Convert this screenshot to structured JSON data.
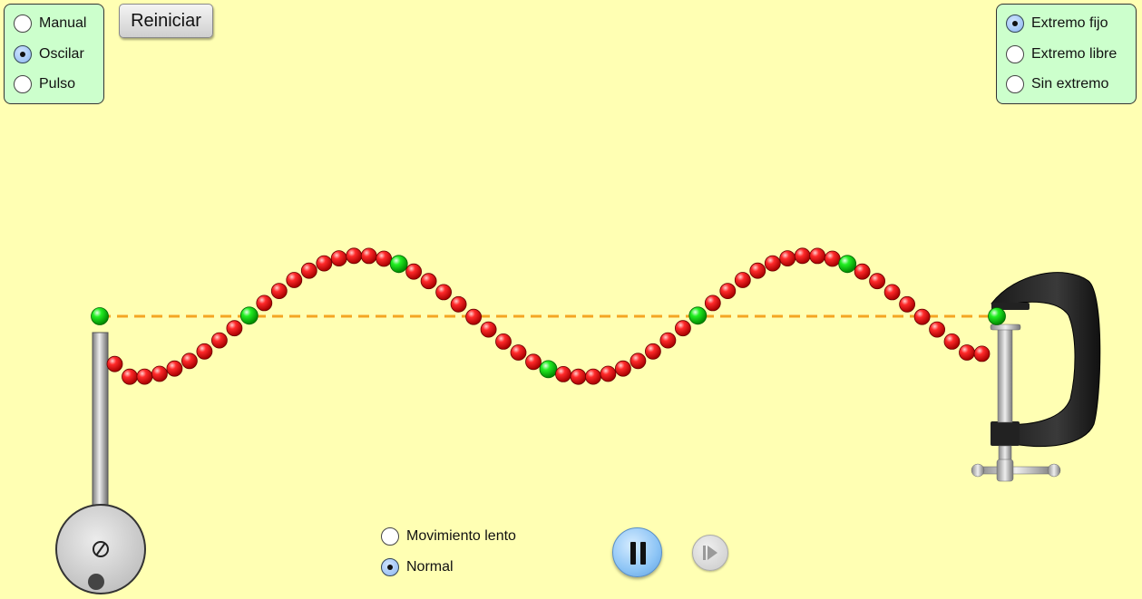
{
  "mode_panel": {
    "options": [
      {
        "label": "Manual",
        "selected": false
      },
      {
        "label": "Oscilar",
        "selected": true
      },
      {
        "label": "Pulso",
        "selected": false
      }
    ]
  },
  "toolbar": {
    "reset_label": "Reiniciar"
  },
  "end_panel": {
    "options": [
      {
        "label": "Extremo fijo",
        "selected": true
      },
      {
        "label": "Extremo libre",
        "selected": false
      },
      {
        "label": "Sin extremo",
        "selected": false
      }
    ]
  },
  "speed": {
    "options": [
      {
        "label": "Movimiento lento",
        "selected": false
      },
      {
        "label": "Normal",
        "selected": true
      }
    ]
  },
  "playback": {
    "state": "playing"
  },
  "colors": {
    "background": "#ffffb3",
    "panel": "#ccffcc",
    "bead_red": "#ee0000",
    "bead_green": "#00dd00",
    "equilibrium_line": "#f4a623"
  },
  "icons": {
    "pause": "pause-icon",
    "step": "step-forward-icon",
    "oscillator": "oscillator-wheel-icon",
    "clamp": "c-clamp-icon"
  }
}
